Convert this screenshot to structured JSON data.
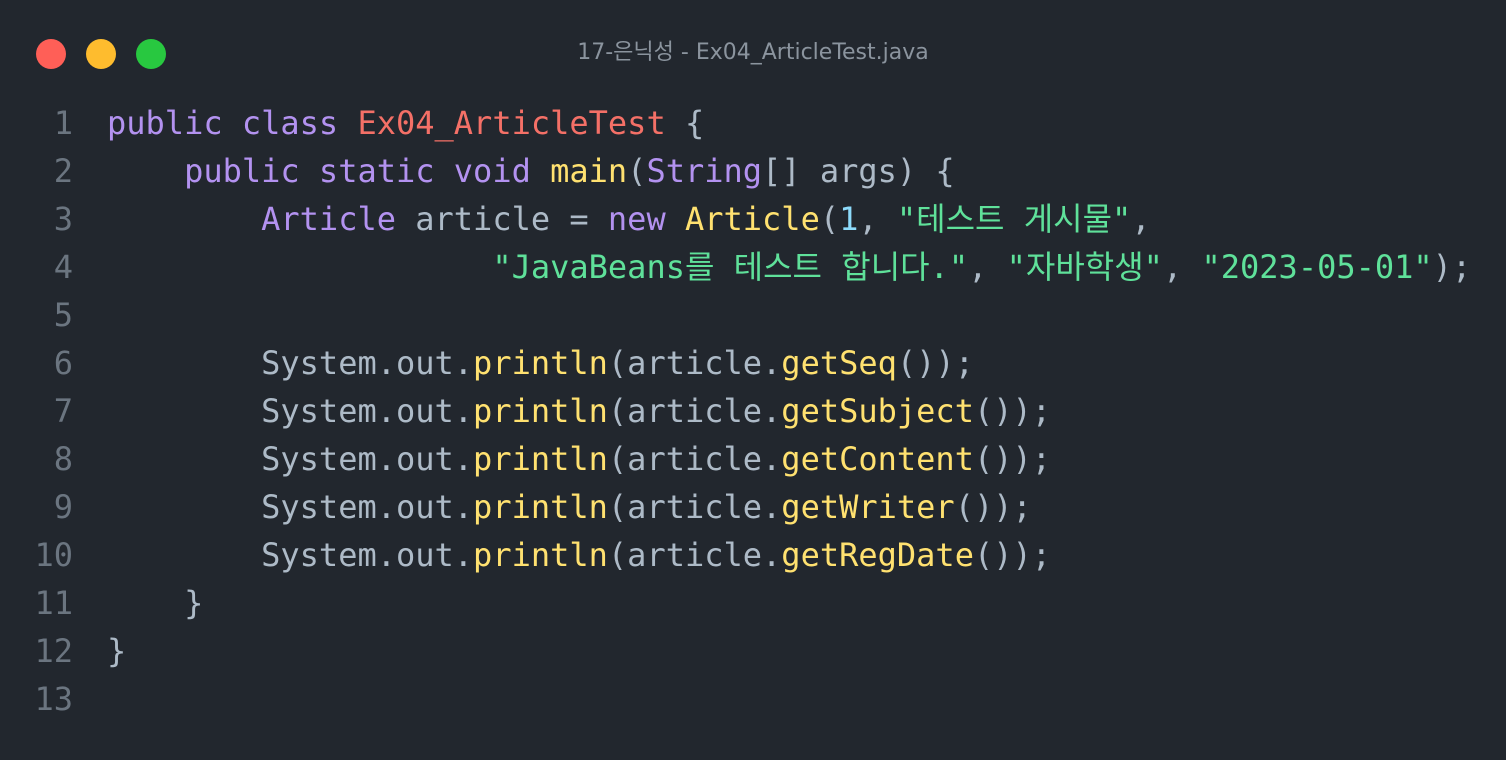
{
  "window": {
    "title": "17-은닉성 - Ex04_ArticleTest.java",
    "buttons": [
      {
        "name": "close",
        "color": "#ff5f57"
      },
      {
        "name": "minimize",
        "color": "#febc2e"
      },
      {
        "name": "maximize",
        "color": "#28c840"
      }
    ]
  },
  "colors": {
    "keyword": "#b392f0",
    "classname": "#f47067",
    "function": "#ffe170",
    "string": "#5fe19a",
    "number": "#8ddbfb",
    "plain": "#adbac7",
    "punct": "#8b949e"
  },
  "code": {
    "lines": [
      {
        "n": "1",
        "tokens": [
          [
            "keyword",
            "public"
          ],
          [
            "plain",
            " "
          ],
          [
            "keyword",
            "class"
          ],
          [
            "plain",
            " "
          ],
          [
            "classname",
            "Ex04_ArticleTest"
          ],
          [
            "plain",
            " {"
          ]
        ]
      },
      {
        "n": "2",
        "tokens": [
          [
            "plain",
            "    "
          ],
          [
            "keyword",
            "public"
          ],
          [
            "plain",
            " "
          ],
          [
            "keyword",
            "static"
          ],
          [
            "plain",
            " "
          ],
          [
            "keyword",
            "void"
          ],
          [
            "plain",
            " "
          ],
          [
            "function",
            "main"
          ],
          [
            "plain",
            "("
          ],
          [
            "keyword",
            "String"
          ],
          [
            "plain",
            "[] args) {"
          ]
        ]
      },
      {
        "n": "3",
        "tokens": [
          [
            "plain",
            "        "
          ],
          [
            "keyword",
            "Article"
          ],
          [
            "plain",
            " article = "
          ],
          [
            "keyword",
            "new"
          ],
          [
            "plain",
            " "
          ],
          [
            "function",
            "Article"
          ],
          [
            "plain",
            "("
          ],
          [
            "number",
            "1"
          ],
          [
            "plain",
            ", "
          ],
          [
            "string",
            "\"테스트 게시물\""
          ],
          [
            "plain",
            ","
          ]
        ]
      },
      {
        "n": "4",
        "tokens": [
          [
            "plain",
            "                    "
          ],
          [
            "string",
            "\"JavaBeans를 테스트 합니다.\""
          ],
          [
            "plain",
            ", "
          ],
          [
            "string",
            "\"자바학생\""
          ],
          [
            "plain",
            ", "
          ],
          [
            "string",
            "\"2023-05-01\""
          ],
          [
            "plain",
            ");"
          ]
        ]
      },
      {
        "n": "5",
        "tokens": []
      },
      {
        "n": "6",
        "tokens": [
          [
            "plain",
            "        System.out."
          ],
          [
            "function",
            "println"
          ],
          [
            "plain",
            "(article."
          ],
          [
            "function",
            "getSeq"
          ],
          [
            "plain",
            "());"
          ]
        ]
      },
      {
        "n": "7",
        "tokens": [
          [
            "plain",
            "        System.out."
          ],
          [
            "function",
            "println"
          ],
          [
            "plain",
            "(article."
          ],
          [
            "function",
            "getSubject"
          ],
          [
            "plain",
            "());"
          ]
        ]
      },
      {
        "n": "8",
        "tokens": [
          [
            "plain",
            "        System.out."
          ],
          [
            "function",
            "println"
          ],
          [
            "plain",
            "(article."
          ],
          [
            "function",
            "getContent"
          ],
          [
            "plain",
            "());"
          ]
        ]
      },
      {
        "n": "9",
        "tokens": [
          [
            "plain",
            "        System.out."
          ],
          [
            "function",
            "println"
          ],
          [
            "plain",
            "(article."
          ],
          [
            "function",
            "getWriter"
          ],
          [
            "plain",
            "());"
          ]
        ]
      },
      {
        "n": "10",
        "tokens": [
          [
            "plain",
            "        System.out."
          ],
          [
            "function",
            "println"
          ],
          [
            "plain",
            "(article."
          ],
          [
            "function",
            "getRegDate"
          ],
          [
            "plain",
            "());"
          ]
        ]
      },
      {
        "n": "11",
        "tokens": [
          [
            "plain",
            "    }"
          ]
        ]
      },
      {
        "n": "12",
        "tokens": [
          [
            "plain",
            "}"
          ]
        ]
      },
      {
        "n": "13",
        "tokens": []
      }
    ]
  }
}
